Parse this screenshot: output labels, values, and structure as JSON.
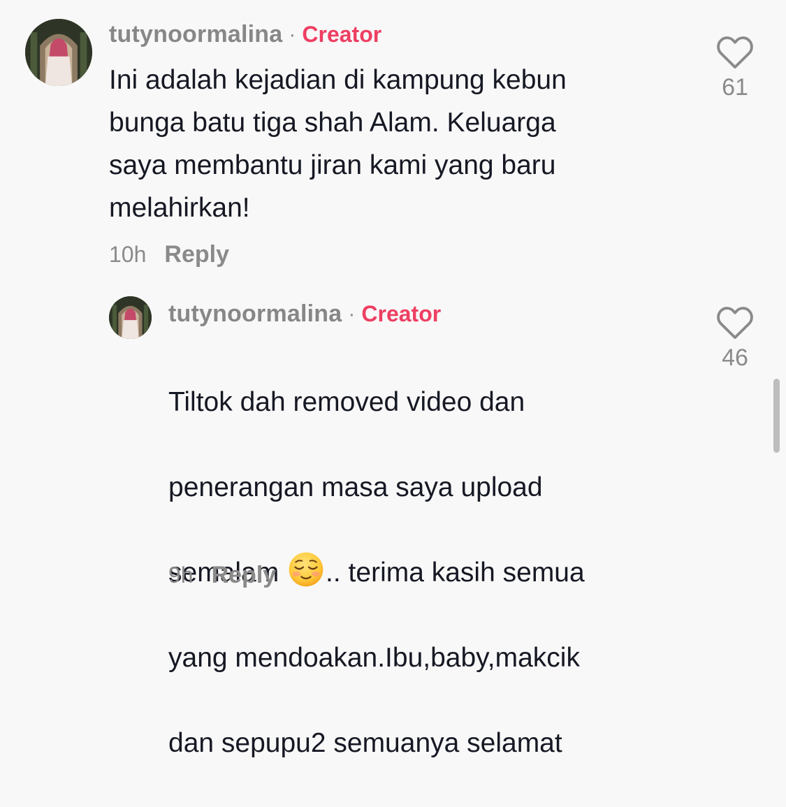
{
  "comments": [
    {
      "username": "tutynoormalina",
      "separator": "·",
      "badge": "Creator",
      "text": "Ini adalah kejadian di kampung kebun\nbunga batu tiga shah Alam. Keluarga\nsaya membantu jiran kami yang baru\nmelahirkan!",
      "time": "10h",
      "reply_label": "Reply",
      "like_count": "61",
      "avatar_icon": "profile-photo-avatar",
      "like_icon": "heart-outline-icon"
    },
    {
      "username": "tutynoormalina",
      "separator": "·",
      "badge": "Creator",
      "text_line1": "Tiltok dah removed video dan",
      "text_line2": "penerangan masa saya upload",
      "text_line3_pre": "semalam ",
      "text_line3_post": ".. terima kasih semua",
      "text_line4": "yang mendoakan.Ibu,baby,makcik",
      "text_line5": "dan sepupu2 semuanya selamat",
      "emoji_icon": "relieved-face-emoji",
      "time": "9h",
      "reply_label": "Reply",
      "like_count": "46",
      "avatar_icon": "profile-photo-avatar",
      "like_icon": "heart-outline-icon"
    }
  ],
  "colors": {
    "background": "#f8f8f8",
    "username": "#878787",
    "creator_badge": "#ee3f62",
    "text": "#161823",
    "muted": "#8a8a8a"
  }
}
